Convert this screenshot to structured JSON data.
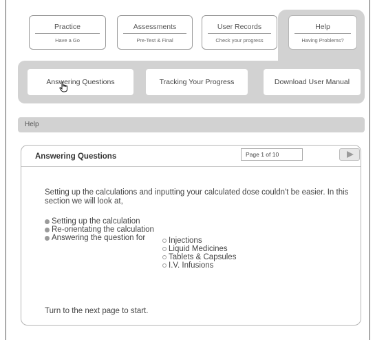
{
  "nav": [
    {
      "title": "Practice",
      "subtitle": "Have a Go"
    },
    {
      "title": "Assessments",
      "subtitle": "Pre-Test & Final"
    },
    {
      "title": "User Records",
      "subtitle": "Check your progress"
    },
    {
      "title": "Help",
      "subtitle": "Having Problems?"
    }
  ],
  "subnav": [
    "Answering Questions",
    "Tracking Your Progress",
    "Download User Manual"
  ],
  "breadcrumb": "Help",
  "panel": {
    "title": "Answering Questions",
    "page": "Page 1 of 10",
    "intro": "Setting up the calculations and inputting your calculated dose couldn't be easier. In this section we will look at,",
    "bullets": [
      "Setting up the calculation",
      "Re-orientating the calculation",
      "Answering the question for"
    ],
    "sub_items": [
      "Injections",
      "Liquid Medicines",
      "Tablets & Capsules",
      "I.V. Infusions"
    ],
    "outro": "Turn to the next page to start."
  },
  "colors": {
    "panel_bg": "#d2d2d2",
    "border": "#9a9a9a"
  },
  "icons": {
    "cursor": "hand-pointer-icon",
    "next": "play-arrow-icon"
  }
}
